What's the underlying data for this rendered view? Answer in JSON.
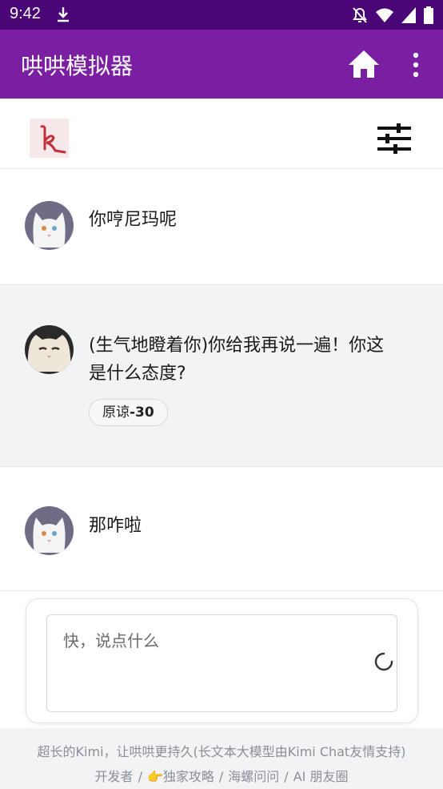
{
  "status_bar": {
    "time": "9:42",
    "icons": [
      "download-icon",
      "notifications-off-icon",
      "wifi-icon",
      "signal-icon",
      "battery-icon"
    ]
  },
  "app_bar": {
    "title": "哄哄模拟器",
    "icons": [
      "home-icon",
      "more-vert-icon"
    ]
  },
  "toolbar": {
    "logo": "k",
    "icons": [
      "sliders-icon"
    ]
  },
  "messages": [
    {
      "role": "user",
      "text": "你哼尼玛呢"
    },
    {
      "role": "assistant",
      "text_line1": "(生气地瞪着你)你给我再说一遍！你这",
      "text_line2": "是什么态度?",
      "badge_label": "原谅",
      "badge_value": "-30"
    },
    {
      "role": "user",
      "text": "那咋啦"
    }
  ],
  "composer": {
    "placeholder": "快，说点什么"
  },
  "footer": {
    "line1": "超长的Kimi，让哄哄更持久(长文本大模型由Kimi Chat友情支持)",
    "links": [
      "开发者",
      "👉独家攻略",
      "海螺问问",
      "AI 朋友圈"
    ],
    "separator": "/"
  },
  "colors": {
    "status_bar": "#4a0577",
    "app_bar": "#7b1fa2",
    "highlight_row": "#f2f3f5"
  }
}
